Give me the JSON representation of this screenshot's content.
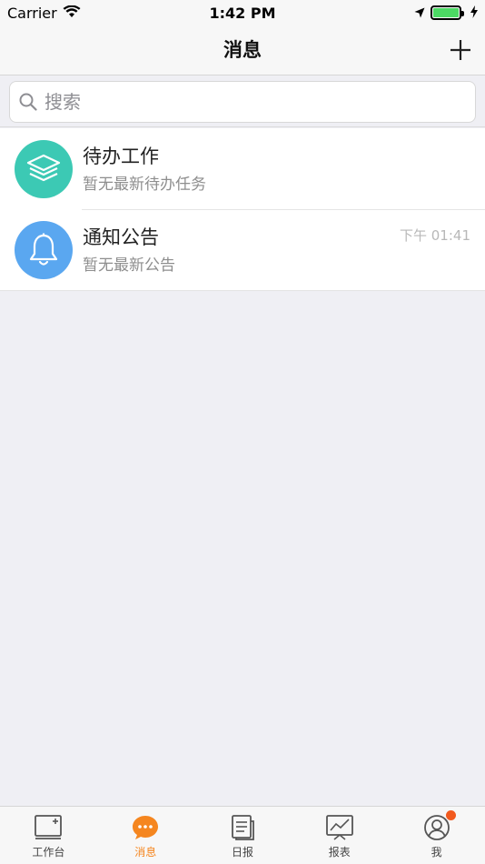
{
  "status_bar": {
    "carrier": "Carrier",
    "time": "1:42 PM",
    "battery_level": 1.0
  },
  "nav": {
    "title": "消息",
    "add_icon": "plus-icon"
  },
  "search": {
    "placeholder": "搜索",
    "value": ""
  },
  "messages": [
    {
      "title": "待办工作",
      "subtitle": "暂无最新待办任务",
      "time": "",
      "icon": "layers-icon",
      "color": "#3cc9b4"
    },
    {
      "title": "通知公告",
      "subtitle": "暂无最新公告",
      "time": "下午 01:41",
      "icon": "bell-icon",
      "color": "#5aa7f0"
    }
  ],
  "tabs": [
    {
      "label": "工作台",
      "icon": "workbench-icon",
      "active": false
    },
    {
      "label": "消息",
      "icon": "message-icon",
      "active": true
    },
    {
      "label": "日报",
      "icon": "daily-report-icon",
      "active": false
    },
    {
      "label": "报表",
      "icon": "chart-report-icon",
      "active": false
    },
    {
      "label": "我",
      "icon": "profile-icon",
      "active": false,
      "badge": true
    }
  ],
  "colors": {
    "accent": "#f5861f",
    "badge": "#f25a1e",
    "background": "#efeff4"
  }
}
